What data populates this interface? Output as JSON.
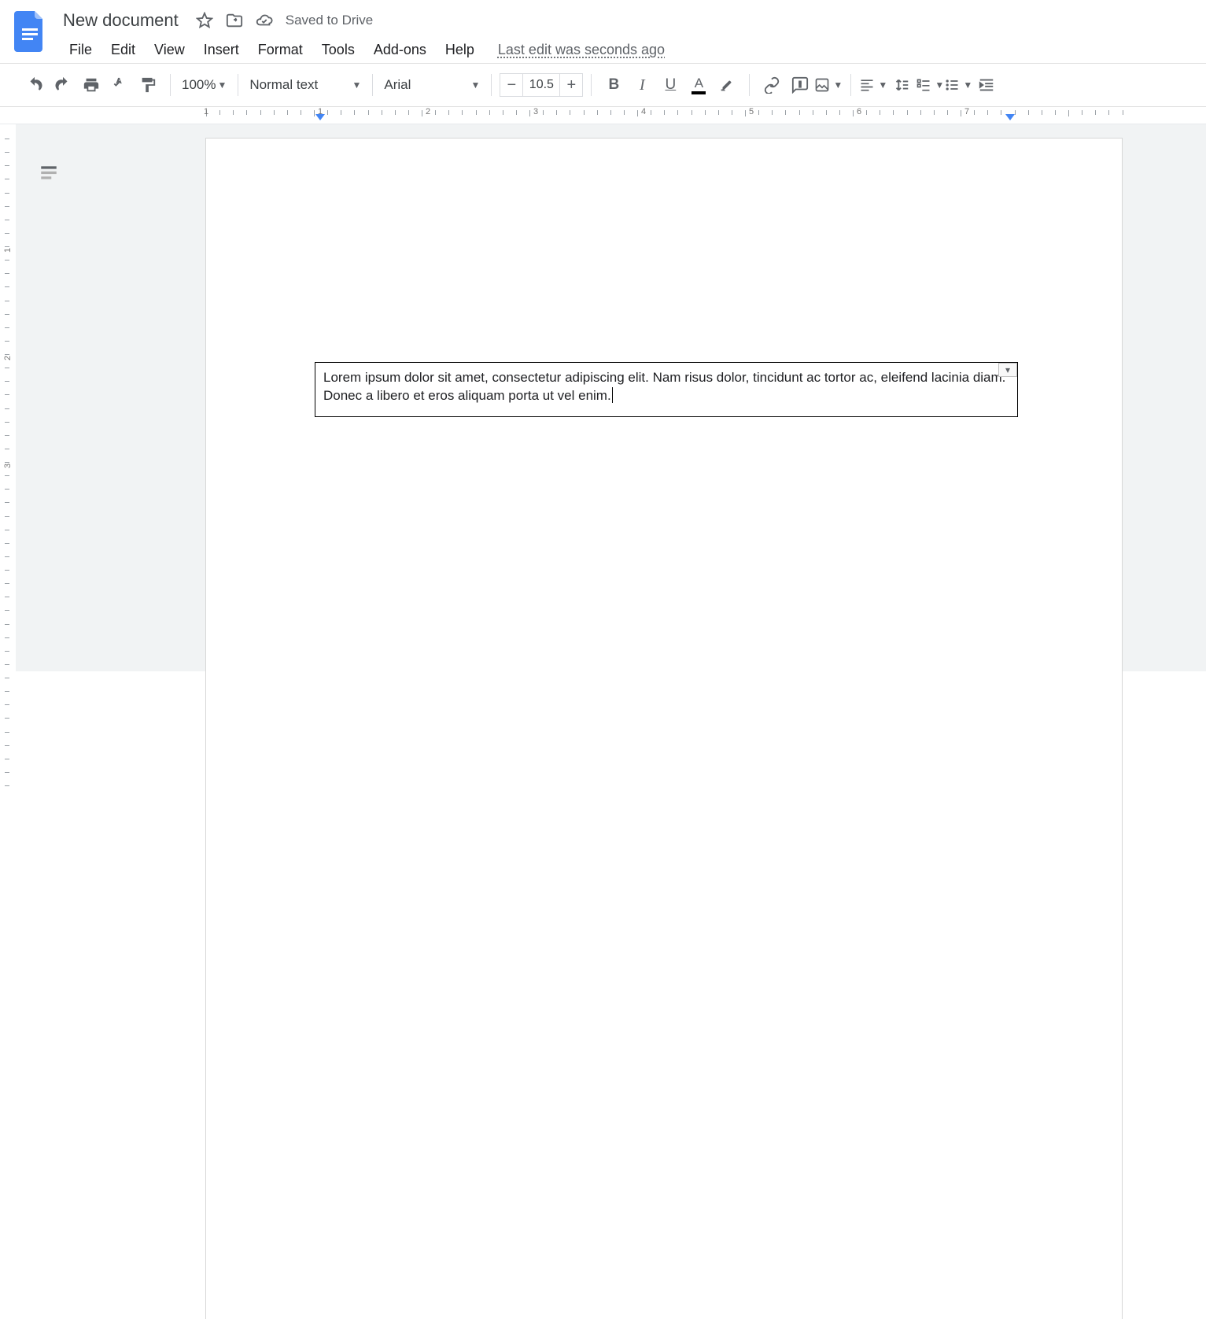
{
  "header": {
    "title": "New document",
    "saved_status": "Saved to Drive",
    "last_edit": "Last edit was seconds ago"
  },
  "menu": {
    "items": [
      "File",
      "Edit",
      "View",
      "Insert",
      "Format",
      "Tools",
      "Add-ons",
      "Help"
    ]
  },
  "toolbar": {
    "zoom": "100%",
    "paragraph_style": "Normal text",
    "font_name": "Arial",
    "font_size": "10.5"
  },
  "ruler": {
    "labels": [
      "1",
      "1",
      "2",
      "3",
      "4",
      "5",
      "6",
      "7"
    ]
  },
  "document": {
    "body_text": "Lorem ipsum dolor sit amet, consectetur adipiscing elit. Nam risus dolor, tincidunt ac tortor ac, eleifend lacinia diam. Donec a libero et eros aliquam porta ut vel enim."
  }
}
